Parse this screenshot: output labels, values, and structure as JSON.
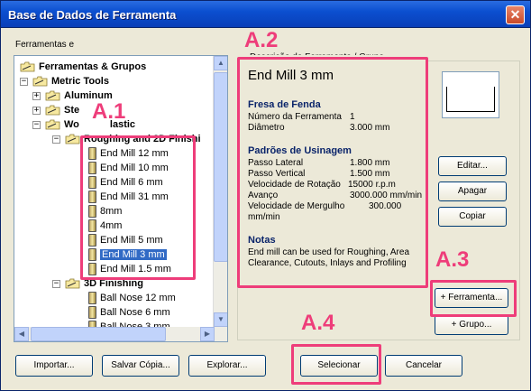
{
  "window": {
    "title": "Base de Dados de Ferramenta",
    "close_glyph": "✕"
  },
  "tree": {
    "label": "Ferramentas e",
    "items": [
      {
        "label": "Ferramentas & Grupos",
        "level": 0,
        "type": "folder-root"
      },
      {
        "label": "Metric Tools",
        "level": 1,
        "type": "folder"
      },
      {
        "label": "Aluminum",
        "level": 2,
        "type": "folder"
      },
      {
        "label": "Ste",
        "level": 2,
        "type": "folder"
      },
      {
        "label": "Wo",
        "level": 2,
        "type": "folder"
      },
      {
        "label": "lastic",
        "level": 2,
        "type": "folder"
      },
      {
        "label": "Roughing and 2D Finishi",
        "level": 3,
        "type": "folder"
      },
      {
        "label": "End Mill 12 mm",
        "level": 4,
        "type": "tool"
      },
      {
        "label": "End Mill 10 mm",
        "level": 4,
        "type": "tool"
      },
      {
        "label": "End Mill 6 mm",
        "level": 4,
        "type": "tool"
      },
      {
        "label": "End Mill 31 mm",
        "level": 4,
        "type": "tool"
      },
      {
        "label": "8mm",
        "level": 4,
        "type": "tool"
      },
      {
        "label": "4mm",
        "level": 4,
        "type": "tool"
      },
      {
        "label": "End Mill 5 mm",
        "level": 4,
        "type": "tool"
      },
      {
        "label": "End Mill 3 mm",
        "level": 4,
        "type": "tool",
        "selected": true
      },
      {
        "label": "End Mill 1.5 mm",
        "level": 4,
        "type": "tool"
      },
      {
        "label": "3D Finishing",
        "level": 3,
        "type": "folder"
      },
      {
        "label": "Ball Nose 12 mm",
        "level": 4,
        "type": "tool"
      },
      {
        "label": "Ball Nose 6 mm",
        "level": 4,
        "type": "tool"
      },
      {
        "label": "Ball Nose 3 mm",
        "level": 4,
        "type": "tool"
      }
    ]
  },
  "description": {
    "header": "Descrição de Ferramenta / Grupo",
    "tool_name": "End Mill 3 mm",
    "section1": {
      "title": "Fresa de Fenda",
      "rows": [
        {
          "label": "Número da Ferramenta",
          "value": "1"
        },
        {
          "label": "Diâmetro",
          "value": "3.000 mm"
        }
      ]
    },
    "section2": {
      "title": "Padrões de Usinagem",
      "rows": [
        {
          "label": "Passo Lateral",
          "value": "1.800 mm"
        },
        {
          "label": "Passo Vertical",
          "value": "1.500 mm"
        },
        {
          "label": "Velocidade de Rotação",
          "value": "15000 r.p.m"
        },
        {
          "label": "Avanço",
          "value": "3000.000 mm/min"
        },
        {
          "label": "Velocidade de Mergulho",
          "value": "300.000"
        },
        {
          "label": "mm/min",
          "value": ""
        }
      ]
    },
    "notes": {
      "title": "Notas",
      "text": "End mill can be used for Roughing, Area Clearance, Cutouts, Inlays and Profiling"
    }
  },
  "buttons": {
    "edit": "Editar...",
    "delete": "Apagar",
    "copy": "Copiar",
    "add_tool": "+ Ferramenta...",
    "add_group": "+ Grupo...",
    "import": "Importar...",
    "save_copy": "Salvar Cópia...",
    "explore": "Explorar...",
    "select": "Selecionar",
    "cancel": "Cancelar"
  },
  "annotations": {
    "a1": "A.1",
    "a2": "A.2",
    "a3": "A.3",
    "a4": "A.4",
    "color": "#ee3d7a"
  },
  "scroll_glyphs": {
    "up": "▲",
    "down": "▼",
    "left": "◀",
    "right": "▶"
  }
}
